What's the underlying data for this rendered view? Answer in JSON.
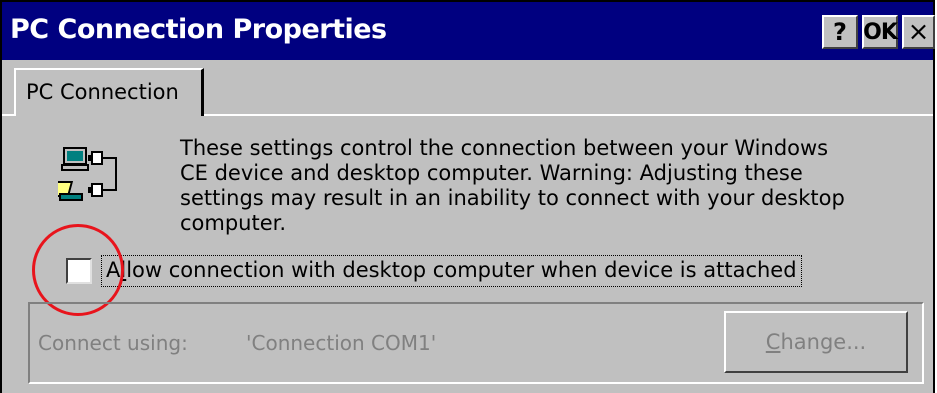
{
  "window": {
    "title": "PC Connection Properties",
    "help_label": "?",
    "ok_label": "OK",
    "close_label": "×"
  },
  "tabs": [
    {
      "label": "PC Connection",
      "selected": true
    }
  ],
  "description": "These settings control the connection between your Windows\nCE device and desktop computer.  Warning: Adjusting these\nsettings may result in an inability to connect with your desktop\ncomputer.",
  "checkbox": {
    "label": "Allow connection with desktop computer when device is attached",
    "checked": false
  },
  "connection": {
    "label": "Connect using:",
    "value": "'Connection COM1'",
    "change_button_label": "Change..."
  },
  "icons": {
    "pc_connection": "pc-connection-icon"
  },
  "colors": {
    "titlebar": "#000080",
    "face": "#c0c0c0",
    "annotation": "#e8141c",
    "disabled_text": "#808080"
  }
}
